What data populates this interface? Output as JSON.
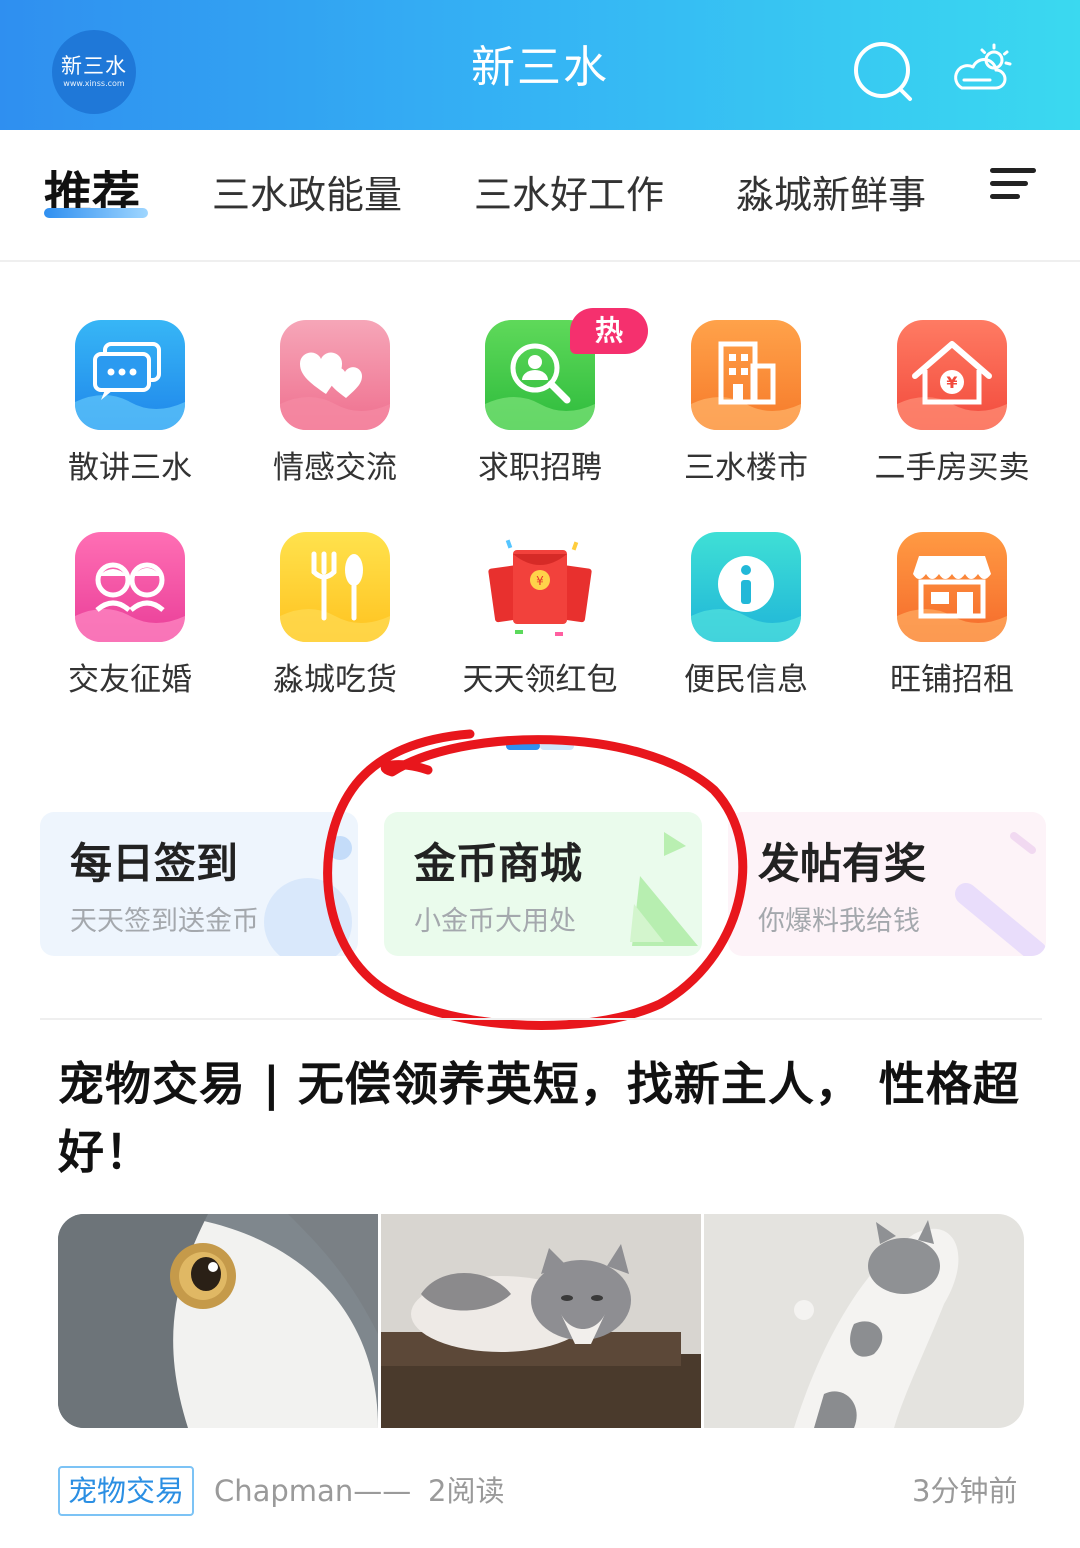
{
  "header": {
    "logo_text": "新三水",
    "logo_url_text": "www.xinss.com",
    "title": "新三水",
    "search_icon": "search-icon",
    "weather_icon": "partly-cloudy-icon"
  },
  "tabs": [
    {
      "label": "推荐",
      "active": true
    },
    {
      "label": "三水政能量"
    },
    {
      "label": "三水好工作"
    },
    {
      "label": "淼城新鲜事"
    }
  ],
  "grid": [
    {
      "label": "散讲三水",
      "icon": "chat-bubbles-icon"
    },
    {
      "label": "情感交流",
      "icon": "hearts-icon"
    },
    {
      "label": "求职招聘",
      "icon": "job-search-icon",
      "badge": "热"
    },
    {
      "label": "三水楼市",
      "icon": "building-icon"
    },
    {
      "label": "二手房买卖",
      "icon": "house-yuan-icon"
    },
    {
      "label": "交友征婚",
      "icon": "couple-icon"
    },
    {
      "label": "淼城吃货",
      "icon": "fork-spoon-icon"
    },
    {
      "label": "天天领红包",
      "icon": "red-envelope-icon"
    },
    {
      "label": "便民信息",
      "icon": "info-icon"
    },
    {
      "label": "旺铺招租",
      "icon": "shop-icon"
    }
  ],
  "cards": [
    {
      "title": "每日签到",
      "subtitle": "天天签到送金币"
    },
    {
      "title": "金币商城",
      "subtitle": "小金币大用处"
    },
    {
      "title": "发帖有奖",
      "subtitle": "你爆料我给钱"
    }
  ],
  "article": {
    "title": "宠物交易 | 无偿领养英短，找新主人， 性格超好！",
    "tag": "宠物交易",
    "author": "Chapman——",
    "reads": "2阅读",
    "time": "3分钟前"
  },
  "colors": {
    "header_start": "#2f8ff0",
    "header_end": "#3ad9f0",
    "annotation": "#e8161c",
    "hot_badge": "#f5306e"
  }
}
